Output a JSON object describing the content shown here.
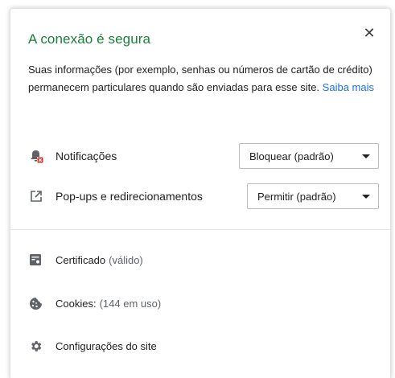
{
  "header": {
    "title": "A conexão é segura",
    "close_glyph": "✕"
  },
  "description": {
    "text": "Suas informações (por exemplo, senhas ou números de cartão de crédito) permanecem particulares quando são enviadas para esse site.",
    "link_label": "Saiba mais"
  },
  "permissions": [
    {
      "icon": "notification-blocked-icon",
      "label": "Notificações",
      "selected": "Bloquear (padrão)"
    },
    {
      "icon": "popup-open-in-new-icon",
      "label": "Pop-ups e redirecionamentos",
      "selected": "Permitir (padrão)"
    }
  ],
  "info_items": [
    {
      "icon": "certificate-icon",
      "label": "Certificado",
      "sub": "(válido)"
    },
    {
      "icon": "cookie-icon",
      "label": "Cookies:",
      "sub": "(144 em uso)"
    },
    {
      "icon": "gear-icon",
      "label": "Configurações do site",
      "sub": ""
    }
  ],
  "colors": {
    "title_green": "#188038",
    "link_blue": "#1a73e8",
    "blocked_badge_red": "#d93025",
    "icon_gray": "#5f6368"
  }
}
